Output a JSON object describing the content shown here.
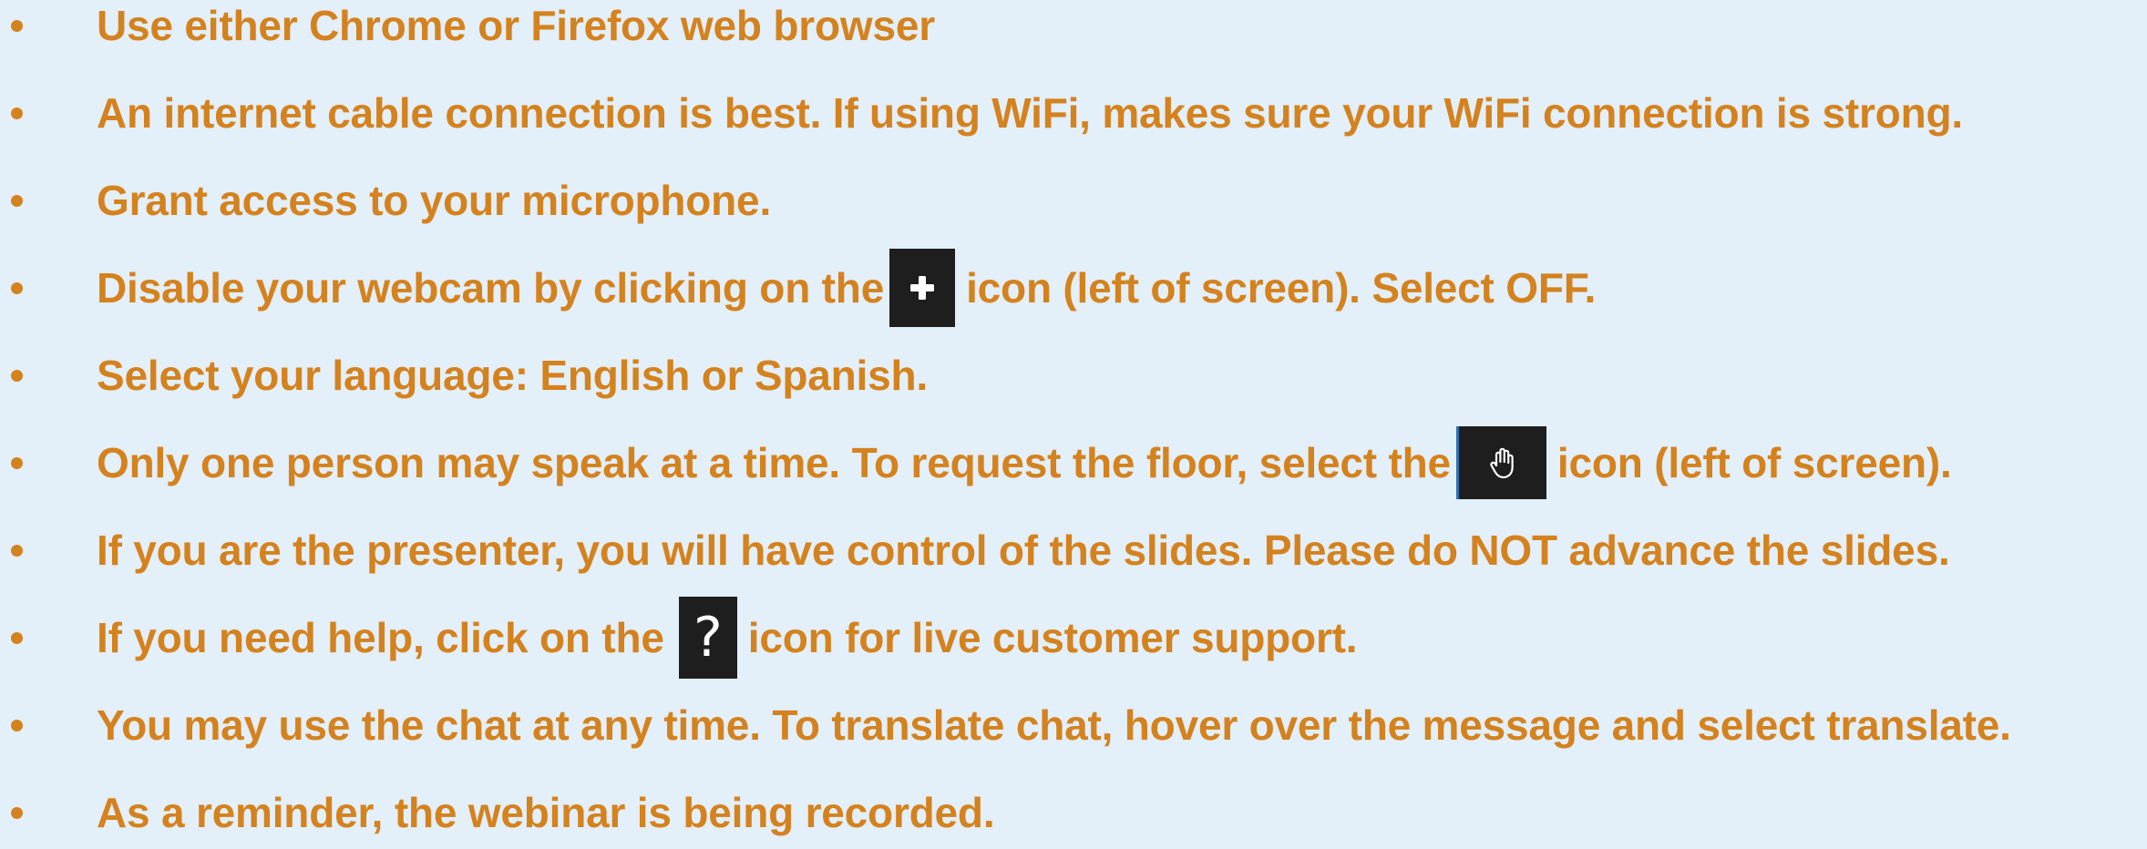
{
  "bullets": [
    {
      "text": "Use either Chrome or Firefox web browser"
    },
    {
      "text": "An internet cable connection is best. If using WiFi, makes sure your WiFi connection is strong."
    },
    {
      "text": "Grant access to your microphone."
    },
    {
      "before": "Disable your webcam by clicking on the",
      "icon": "plus-icon",
      "after": "icon (left of screen). Select OFF."
    },
    {
      "text": "Select your language: English or Spanish."
    },
    {
      "before": "Only one person may speak at a time. To request the floor, select the",
      "icon": "raise-hand-icon",
      "after": "icon (left of screen)."
    },
    {
      "text": "If you are the presenter, you will have control of the slides. Please do NOT advance the slides."
    },
    {
      "before": "If you need help, click on the",
      "icon": "help-icon",
      "icon_glyph": "?",
      "after": "icon for live customer support."
    },
    {
      "text": "You may use the chat at any time. To translate chat, hover over the message and select translate."
    },
    {
      "text": "As a reminder, the webinar is being recorded."
    }
  ],
  "colors": {
    "background": "#e3eff9",
    "text": "#d4821e",
    "icon_background": "#1e1e1e",
    "icon_foreground": "#ffffff"
  }
}
